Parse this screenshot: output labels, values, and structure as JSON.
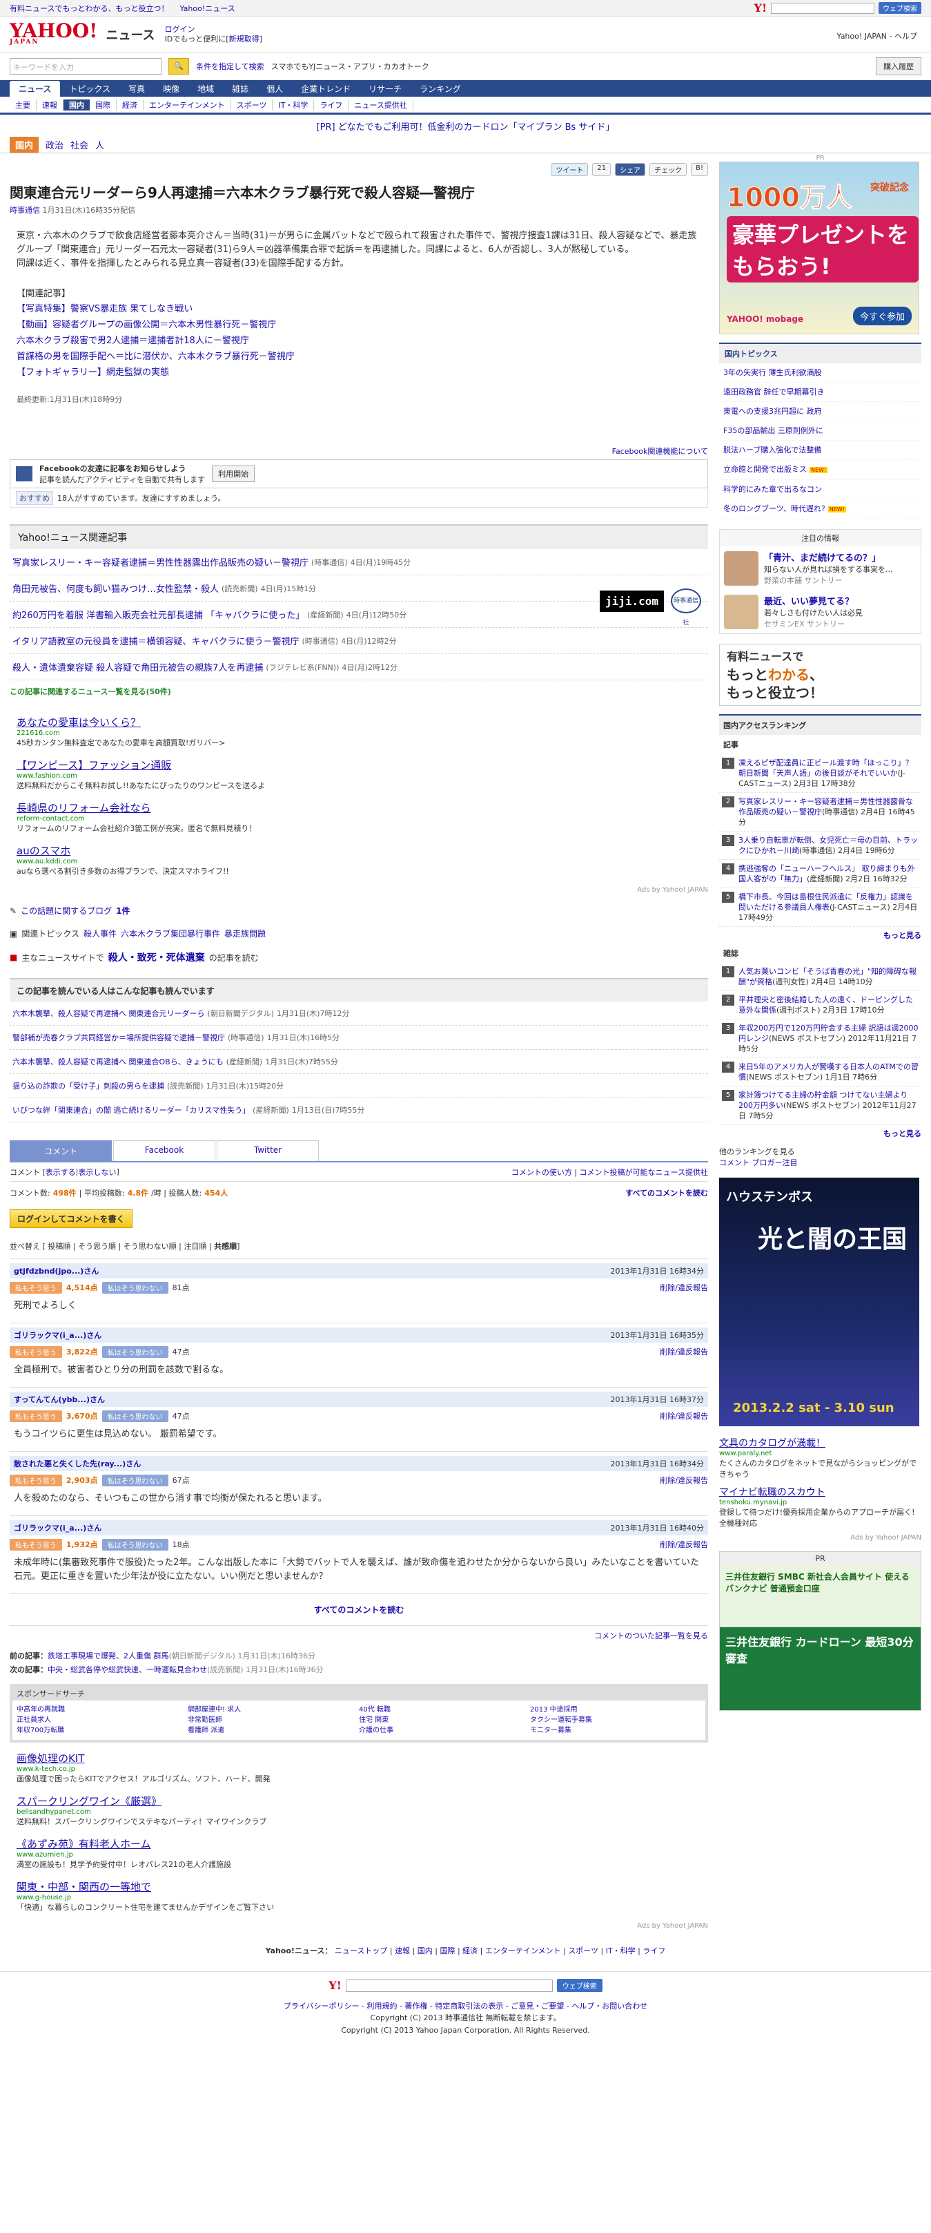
{
  "topbar": {
    "links": [
      "有料ニュースでもっとわかる、もっと役立つ！",
      "Yahoo!ニュース"
    ],
    "search_btn": "ウェブ検索"
  },
  "brand": {
    "logo": "YAHOO!",
    "logo_sub": "JAPAN",
    "service": "ニュース",
    "login": "ログイン",
    "login_note": "IDでもっと便利に[",
    "register": "新規取得",
    "register_close": "]",
    "right": "Yahoo! JAPAN - ヘルプ"
  },
  "search": {
    "placeholder": "キーワードを入力",
    "cond": "条件を指定して検索",
    "links": "スマホでもYJニュース・アプリ・カカオトーク",
    "buy": "購入履歴"
  },
  "gnav": [
    "ニュース",
    "トピックス",
    "写真",
    "映像",
    "地域",
    "雑誌",
    "個人",
    "企業トレンド",
    "リサーチ",
    "ランキング"
  ],
  "subnav": [
    "主要",
    "速報",
    "国内",
    "国際",
    "経済",
    "エンターテインメント",
    "スポーツ",
    "IT・科学",
    "ライフ",
    "ニュース提供社"
  ],
  "pr": "[PR] どなたでもご利用可！低金利のカードロン「マイプラン Bs サイド」",
  "cat": [
    "国内",
    "政治",
    "社会",
    "人"
  ],
  "share": {
    "tweet": "ツイート",
    "tweet_count": "21",
    "fb": "シェア",
    "check": "チェック",
    "hatena": "B!"
  },
  "article": {
    "title": "関東連合元リーダーら9人再逮捕＝六本木クラブ暴行死で殺人容疑―警視庁",
    "source": "時事通信",
    "date": "1月31日(木)16時35分配信",
    "body": [
      "東京・六本木のクラブで飲食店経営者藤本亮介さん＝当時(31)＝が男らに金属バットなどで殴られて殺害された事件で、警視庁捜査1課は31日、殺人容疑などで、暴走族グループ「関東連合」元リーダー石元太一容疑者(31)ら9人＝凶器準備集合罪で起訴＝を再逮捕した。同課によると、6人が否認し、3人が黙秘している。",
      "同課は近く、事件を指揮したとみられる見立真一容疑者(33)を国際手配する方針。"
    ],
    "rel_heading": "【関連記事】",
    "related": [
      "【写真特集】警察VS暴走族 果てしなき戦い",
      "【動画】容疑者グループの画像公開＝六本木男性暴行死－警視庁",
      "六本木クラブ殺害で男2人逮捕＝逮捕者計18人に－警視庁",
      "首謀格の男を国際手配へ＝比に潜伏か、六本木クラブ暴行死－警視庁",
      "【フォトギャラリー】網走監獄の実態"
    ],
    "updated": "最終更新:1月31日(木)18時9分",
    "jiji_logo": "jiji.com",
    "jiji_mark": "時事通信社"
  },
  "fb": {
    "note": "Facebook関連機能について",
    "title": "Facebookの友達に記事をお知らせしよう",
    "desc": "記事を読んだアクティビティを自動で共有します",
    "btn": "利用開始",
    "like": "おすすめ",
    "like_text": "18人がすすめています。友達にすすめましょう。"
  },
  "related_section": {
    "heading": "Yahoo!ニュース関連記事",
    "rows": [
      {
        "t": "写真家レスリー・キー容疑者逮捕＝男性性器露出作品販売の疑い－警視庁",
        "s": "(時事通信)",
        "d": "4日(月)19時45分"
      },
      {
        "t": "角田元被告、何度も飼い猫みつけ…女性監禁・殺人",
        "s": "(読売新聞)",
        "d": "4日(月)15時1分"
      },
      {
        "t": "約260万円を着服 洋書輸入販売会社元部長逮捕 「キャバクラに使った」",
        "s": "(産経新聞)",
        "d": "4日(月)12時50分"
      },
      {
        "t": "イタリア語教室の元役員を逮捕＝横領容疑、キャバクラに使う－警視庁",
        "s": "(時事通信)",
        "d": "4日(月)12時2分"
      },
      {
        "t": "殺人・遺体遺棄容疑 殺人容疑で角田元被告の親族7人を再逮捕",
        "s": "(フジテレビ系(FNN))",
        "d": "4日(月)2時12分"
      }
    ],
    "more": "この記事に関連するニュース一覧を見る(50件)"
  },
  "ads": [
    {
      "t": "あなたの愛車は今いくら？",
      "u": "221616.com",
      "d": "45秒カンタン無料査定であなたの愛車を高額買取!ガリバー>"
    },
    {
      "t": "【ワンピース】ファッション通販",
      "u": "www.fashion.com",
      "d": "送料無料だからこそ無料お試し!!あなたにぴったりのワンピースを送るよ"
    },
    {
      "t": "長崎県のリフォーム会社なら",
      "u": "reform-contact.com",
      "d": "リフォームのリフォーム会社紹介3箇工例が充実。匿名で無料見積り！"
    },
    {
      "t": "auのスマホ",
      "u": "www.au.kddi.com",
      "d": "auなら選べる割引き多数のお得プランで、決定スマホライフ!!"
    }
  ],
  "adsby": "Ads by Yahoo! JAPAN",
  "blog": {
    "label": "この話題に関するブログ",
    "count": "1件"
  },
  "topics": {
    "label": "関連トピックス",
    "items": [
      "殺人事件",
      "六本木クラブ集団暴行事件",
      "暴走族問題"
    ]
  },
  "mainsite": {
    "label": "主なニュースサイトで",
    "kw": "殺人・致死・死体遺棄",
    "suffix": "の記事を読む"
  },
  "readers": {
    "heading": "この記事を読んでいる人はこんな記事も読んでいます",
    "rows": [
      {
        "t": "六本木襲撃、殺人容疑で再逮捕へ 関東連合元リーダーら",
        "s": "(朝日新聞デジタル)",
        "d": "1月31日(木)7時12分"
      },
      {
        "t": "警部補が売春クラブ共同経営か＝場所提供容疑で逮捕－警視庁",
        "s": "(時事通信)",
        "d": "1月31日(木)16時5分"
      },
      {
        "t": "六本木襲撃、殺人容疑で再逮捕へ 関東連合OBら、きょうにも",
        "s": "(産経新聞)",
        "d": "1月31日(木)7時55分"
      },
      {
        "t": "揺り込の詐欺の「受け子」刺殺の男らを逮捕",
        "s": "(読売新聞)",
        "d": "1月31日(木)15時20分"
      },
      {
        "t": "いびつな絆「関東連合」の闇 逃亡続けるリーダー「カリスマ性失う」",
        "s": "(産経新聞)",
        "d": "1月13日(日)7時55分"
      }
    ]
  },
  "ctabs": [
    "コメント",
    "Facebook",
    "Twitter"
  ],
  "comments": {
    "show_label": "コメント [",
    "show": "表示する",
    "sep": " | ",
    "hide": "表示しない",
    "close": " ]",
    "guide": "コメントの使い方",
    "guide2": " | ",
    "list": "コメント投稿が可能なニュース提供社",
    "count_label": "コメント数:",
    "count": "498件",
    "avg_label": " | 平均投稿数:",
    "avg": "4.8件",
    "avg_unit": "/時 | 投稿人数:",
    "people": "454人",
    "readall": "すべてのコメントを読む",
    "login": "ログインしてコメントを書く",
    "sort": "並べ替え [ 投稿順 | そう思う順 | そう思わない順 | 注目順 | ",
    "sort_last": "共感順",
    "sort_end": "]",
    "agree": "私もそう思う",
    "disagree": "私はそう思わない",
    "report": "削除/違反報告",
    "items": [
      {
        "u": "gtjfdzbnd(jpo...)さん",
        "t": "2013年1月31日 16時34分",
        "a": "4,514点",
        "d": "81点",
        "b": "死刑でよろしく"
      },
      {
        "u": "ゴリラックマ(i_a...)さん",
        "t": "2013年1月31日 16時35分",
        "a": "3,822点",
        "d": "47点",
        "b": "全員極刑で。被害者ひとり分の刑罰を該数で割るな。"
      },
      {
        "u": "すってんてん(ybb...)さん",
        "t": "2013年1月31日 16時37分",
        "a": "3,670点",
        "d": "47点",
        "b": "もうコイツらに更生は見込めない。 厳罰希望です。"
      },
      {
        "u": "散された悪と失くした先(ray...)さん",
        "t": "2013年1月31日 16時34分",
        "a": "2,903点",
        "d": "67点",
        "b": "人を殺めたのなら、そいつもこの世から消す事で均衡が保たれると思います。"
      },
      {
        "u": "ゴリラックマ(i_a...)さん",
        "t": "2013年1月31日 16時40分",
        "a": "1,932点",
        "d": "18点",
        "b": "未成年時に(集審致死事件で服役)たった2年。こんな出版した本に「大勢でバットで人を襲えば、誰が致命傷を追わせたか分からないから良い」みたいなことを書いていた石元。更正に重きを置いた少年法が役に立たない。いい例だと思いませんか？"
      }
    ],
    "readall2": "すべてのコメントを読む",
    "listmore": "コメントのついた記事一覧を見る"
  },
  "prevnext": {
    "prev_l": "前の記事：",
    "prev": "鉄塔工事現場で爆発、2人重傷 群馬",
    "prev_s": "(朝日新聞デジタル)",
    "prev_d": "1月31日(木)16時36分",
    "next_l": "次の記事：",
    "next": "中央・総武各停や総武快速、一時運転見合わせ",
    "next_s": "(読売新聞)",
    "next_d": "1月31日(木)16時36分"
  },
  "sponsor": {
    "head": "スポンサードサーチ",
    "cells": [
      "中高年の再就職",
      "網部屋連中! 求人",
      "40代 転職",
      "2013 中途採用",
      "正社員求人",
      "非常勤医師",
      "住宅 関東",
      "タクシー運転手募集",
      "年収700万転職",
      "看護師 派遣",
      "介護の仕事",
      "モニター募集"
    ]
  },
  "ads2": [
    {
      "t": "画像処理のKIT",
      "u": "www.k-tech.co.jp",
      "d": "画像処理で困ったらKITでアクセス！アルゴリズム、ソフト、ハード、開発"
    },
    {
      "t": "スパークリングワイン《厳選》",
      "u": "bellsandhypanet.com",
      "d": "送料無料！スパークリングワインでステキなパーティ！マイワインクラブ"
    },
    {
      "t": "《あずみ苑》有料老人ホーム",
      "u": "www.azumien.jp",
      "d": "満室の施設も！見学予約受付中！レオパレス21の老人介護施設"
    },
    {
      "t": "関東・中部・関西の一等地で",
      "u": "www.g-house.jp",
      "d": "「快適」な暮らしのコンクリート住宅を建てませんかデザインをご覧下さい"
    }
  ],
  "footnav": {
    "label": "Yahoo!ニュース：",
    "items": [
      "ニューストップ",
      "速報",
      "国内",
      "国際",
      "経済",
      "エンターテインメント",
      "スポーツ",
      "IT・科学",
      "ライフ"
    ]
  },
  "footsearch": "ウェブ検索",
  "footlinks": "プライバシーポリシー - 利用規約 - 著作権 - 特定商取引法の表示 - ご意見・ご要望 - ヘルプ・お問い合わせ",
  "copy1": "Copyright (C) 2013 時事通信社 無断転載を禁じます。",
  "copy2": "Copyright (C) 2013 Yahoo Japan Corporation. All Rights Reserved.",
  "side": {
    "pr": "PR",
    "banner": {
      "b1": "1000万人",
      "b1s": "突破記念",
      "b2": "豪華プレゼントをもらおう!",
      "b3": "今すぐ参加",
      "b4": "YAHOO! mobage"
    },
    "topics_h": "国内トピックス",
    "topics": [
      {
        "t": "3年の矢実行 薄生氏利欲満股",
        "n": ""
      },
      {
        "t": "遠田政務官 辞任で早期幕引き",
        "n": ""
      },
      {
        "t": "東電への支援3兆円超に 政府",
        "n": ""
      },
      {
        "t": "F35の部品輸出 三原則例外に",
        "n": ""
      },
      {
        "t": "脱法ハーブ購入強化で法整備",
        "n": ""
      },
      {
        "t": "立命館と開発で出版ミス",
        "n": "NEW!"
      },
      {
        "t": "科学的にみた章で出るなコン",
        "n": ""
      },
      {
        "t": "冬のロングブーツ、時代遅れ?",
        "n": "NEW!"
      }
    ],
    "att_h": "注目の情報",
    "att": [
      {
        "t": "「青汁、まだ続けてるの？」",
        "d": "知らない人が見れば損をする事実を...",
        "s": "野菜の本舗 サントリー"
      },
      {
        "t": "最近、いい夢見てる？",
        "d": "若々しさも付けたい人は必見",
        "s": "セサミンEX サントリー"
      }
    ],
    "paid1": "有料ニュースで",
    "paid2": "もっと",
    "paid3": "わかる",
    "paid4": "、",
    "paid5": "もっと役立つ！",
    "rank_h": "国内アクセスランキング",
    "rank_s": "記事",
    "rank": [
      {
        "t": "凍えるピザ配達員に正ビール渡す時「ほっこり」？朝日新聞「天声人語」の後日談がそれでいいか",
        "s": "(J-CASTニュース) 2月3日 17時38分"
      },
      {
        "t": "写真家レスリー・キー容疑者逮捕＝男性性器露骨な作品販売の疑い－警視庁",
        "s": "(時事通信) 2月4日 16時45分"
      },
      {
        "t": "3人乗り自転車が転倒、女児死亡＝母の目前、トラックにひかれ－川崎",
        "s": "(時事通信) 2月4日 19時6分"
      },
      {
        "t": "携逃強奪の「ニューハーフヘルス」 取り締まりも外国人客がの「無力」",
        "s": "(産経新聞) 2月2日 16時32分"
      },
      {
        "t": "橋下市長、今回は島根住民派遣に「反権力」認識を問いただける参議員人権表",
        "s": "(J-CASTニュース) 2月4日 17時49分"
      }
    ],
    "rank_more": "もっと見る",
    "zasshi_h": "雑誌",
    "zasshi": [
      {
        "t": "人気お菓いコンビ「そうば青春の光」\"知的障碍な報酬\"が資格",
        "s": "(週刊女性) 2月4日 14時10分"
      },
      {
        "t": "平井理央と密後結婚した人の遠く、ドーピングした意外な関係",
        "s": "(週刊ポスト) 2月3日 17時10分"
      },
      {
        "t": "年収200万円で120万円貯金する主婦 訳語は週2000円レンジ",
        "s": "(NEWS ポストセブン) 2012年11月21日 7時5分"
      },
      {
        "t": "来日5年のアメリカ人が驚嘆する日本人のATMでの習慣",
        "s": "(NEWS ポストセブン) 1月1日 7時6分"
      },
      {
        "t": "家計簿つけてる主婦の貯金額 つけてない主婦より200万円多い",
        "s": "(NEWS ポストセブン) 2012年11月27日 7時5分"
      }
    ],
    "zasshi_more": "もっと見る",
    "other_l": "他のランキングを見る",
    "other1": "コメント",
    "other2": "ブロガー注目",
    "hts": {
      "t1": "ハウステンボス",
      "t2": "光と闇の王国",
      "t3": "2013.2.2 sat - 3.10 sun"
    },
    "sads": [
      {
        "t": "文具のカタログが満載！",
        "u": "www.paraly.net",
        "d": "たくさんのカタログをネットで見ながらショッピングができちゃう"
      },
      {
        "t": "マイナビ転職のスカウト",
        "u": "tenshoku.mynavi.jp",
        "d": "登録して待つだけ!優秀採用企業からのアプローチが届く!全機種対応"
      }
    ],
    "sadsby": "Ads by Yahoo! JAPAN",
    "smbc_h": "PR",
    "smbc_a": "三井住友銀行 SMBC 新社会人会員サイト 使えるバンクナビ 普通預金口座",
    "smbc_b": "三井住友銀行 カードローン 最短30分審査"
  }
}
